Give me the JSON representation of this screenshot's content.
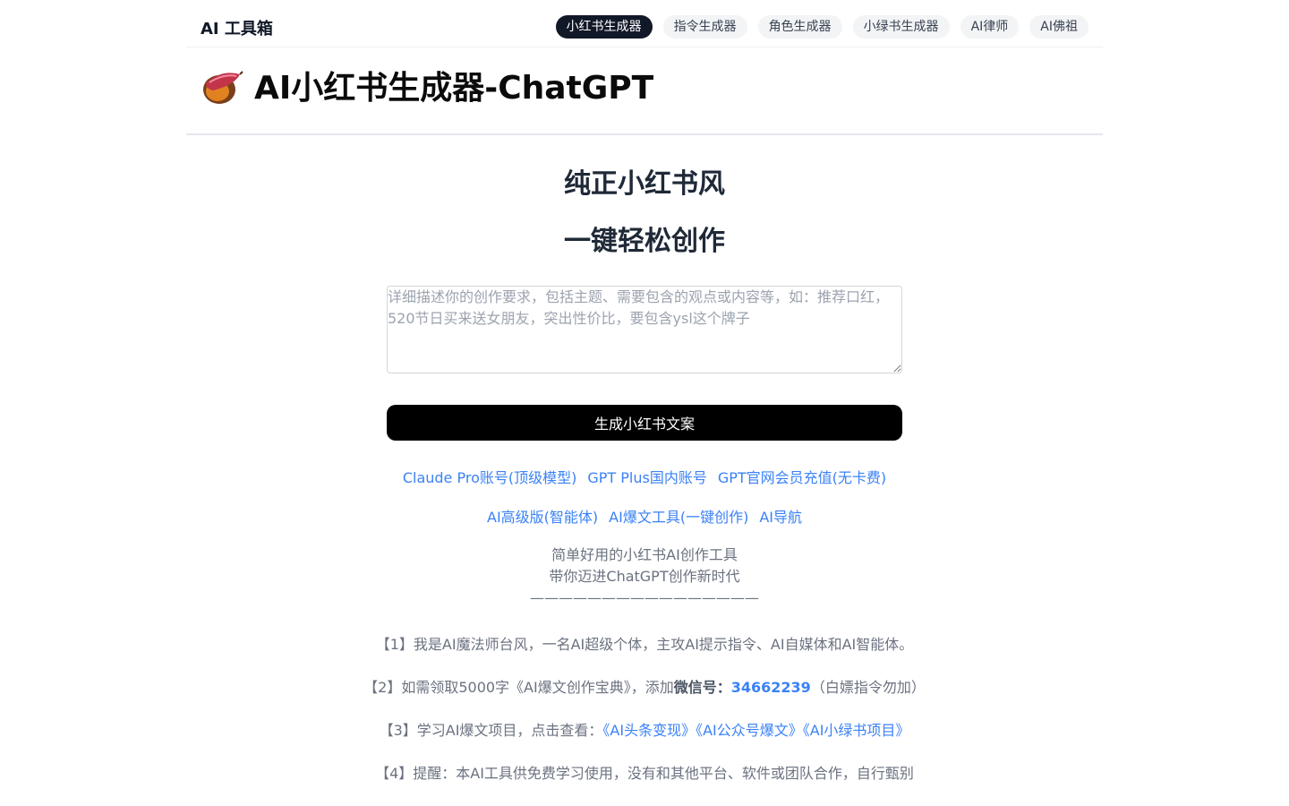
{
  "brand": "AI 工具箱",
  "nav": [
    {
      "label": "小红书生成器",
      "active": true
    },
    {
      "label": "指令生成器",
      "active": false
    },
    {
      "label": "角色生成器",
      "active": false
    },
    {
      "label": "小绿书生成器",
      "active": false
    },
    {
      "label": "AI律师",
      "active": false
    },
    {
      "label": "AI佛祖",
      "active": false
    }
  ],
  "header": {
    "title": "AI小红书生成器-ChatGPT",
    "logo_icon": "sweet-potato-icon"
  },
  "slogan": {
    "line1": "纯正小红书风",
    "line2": "一键轻松创作"
  },
  "prompt": {
    "value": "",
    "placeholder": "详细描述你的创作要求，包括主题、需要包含的观点或内容等，如：推荐口红，520节日买来送女朋友，突出性价比，要包含ysl这个牌子"
  },
  "generate_button": "生成小红书文案",
  "links_row1": [
    "Claude Pro账号(顶级模型)",
    "GPT Plus国内账号",
    "GPT官网会员充值(无卡费)"
  ],
  "links_row2": [
    "AI高级版(智能体)",
    "AI爆文工具(一键创作)",
    "AI导航"
  ],
  "tagline": {
    "line1": "简单好用的小红书AI创作工具",
    "line2": "带你迈进ChatGPT创作新时代",
    "line3": "————————————————"
  },
  "para1": "【1】我是AI魔法师台风，一名AI超级个体，主攻AI提示指令、AI自媒体和AI智能体。",
  "para2": {
    "prefix": "【2】如需领取5000字《AI爆文创作宝典》，添加",
    "wechat_label": "微信号：",
    "wechat_id": "34662239",
    "suffix": "（白嫖指令勿加）"
  },
  "para3": {
    "prefix": "【3】学习AI爆文项目，点击查看：",
    "links": [
      "《AI头条变现》",
      "《AI公众号爆文》",
      "《AI小绿书项目》"
    ]
  },
  "para4": "【4】提醒：本AI工具供免费学习使用，没有和其他平台、软件或团队合作，自行甄别",
  "colors": {
    "accent": "#111827",
    "link": "#3b82f6",
    "button": "#000000",
    "muted_text": "#6b7280"
  }
}
